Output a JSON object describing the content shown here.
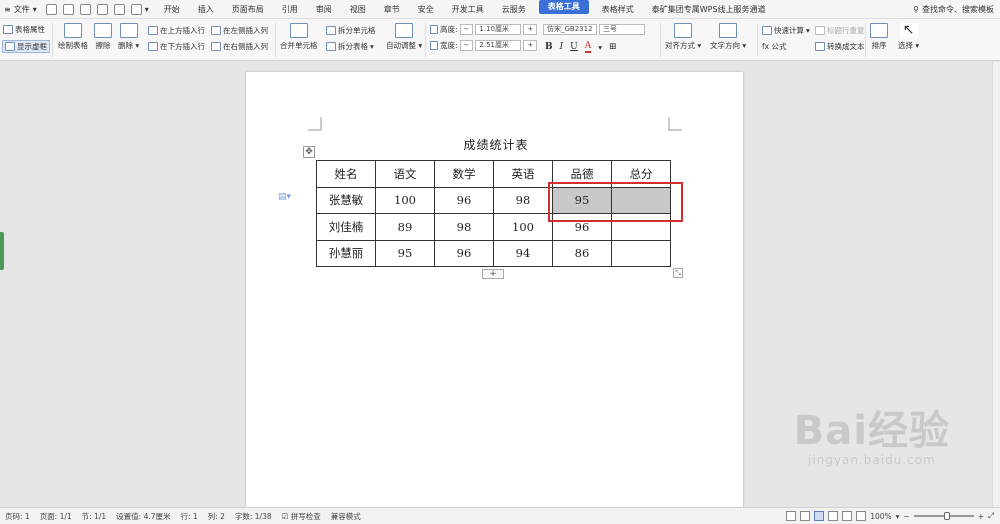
{
  "menubar": {
    "file_label": "文件",
    "tabs": [
      "开始",
      "插入",
      "页面布局",
      "引用",
      "审阅",
      "视图",
      "章节",
      "安全",
      "开发工具",
      "云服务",
      "表格工具",
      "表格样式",
      "泰矿集团专属WPS线上服务通道"
    ],
    "active_tab": "表格工具",
    "search_label": "查找命令、搜索模板"
  },
  "ribbon": {
    "table_props": "表格属性",
    "show_grid": "显示虚框",
    "draw_table": "绘制表格",
    "erase": "擦除",
    "delete": "删除",
    "insert_above": "在上方插入行",
    "insert_below": "在下方插入行",
    "insert_left": "在左侧插入列",
    "insert_right": "在右侧插入列",
    "merge_cells": "合并单元格",
    "split_cells": "拆分单元格",
    "split_table": "拆分表格",
    "auto_fit": "自动调整",
    "height_label": "高度:",
    "height_value": "1.10厘米",
    "width_label": "宽度:",
    "width_value": "2.51厘米",
    "font_name": "仿宋_GB2312",
    "font_size": "三号",
    "bold": "B",
    "italic": "I",
    "underline": "U",
    "font_color": "A",
    "align": "对齐方式",
    "text_direction": "文字方向",
    "quick_calc": "快速计算",
    "formula": "fx 公式",
    "repeat_header": "标题行重复",
    "to_text": "转换成文本",
    "sort": "排序",
    "select": "选择"
  },
  "document": {
    "title": "成绩统计表",
    "table": {
      "headers": [
        "姓名",
        "语文",
        "数学",
        "英语",
        "品德",
        "总分"
      ],
      "rows": [
        [
          "张慧敏",
          "100",
          "96",
          "98",
          "95",
          ""
        ],
        [
          "刘佳楠",
          "89",
          "98",
          "100",
          "96",
          ""
        ],
        [
          "孙慧丽",
          "95",
          "96",
          "94",
          "86",
          ""
        ]
      ]
    },
    "add_row_symbol": "+",
    "move_symbol": "✥"
  },
  "watermark": {
    "line1": "Bai经验",
    "line2": "jingyan.baidu.com"
  },
  "statusbar": {
    "page_num": "页码: 1",
    "pages": "页面: 1/1",
    "section": "节: 1/1",
    "setting": "设置值: 4.7厘米",
    "row": "行: 1",
    "col": "列: 2",
    "words": "字数: 1/38",
    "spell_check": "拼写检查",
    "compat_mode": "兼容模式",
    "zoom": "100%"
  },
  "colors": {
    "accent": "#3a6fd8",
    "highlight_cell": "#c8c8c8",
    "annotation_box": "#d32f2f"
  }
}
